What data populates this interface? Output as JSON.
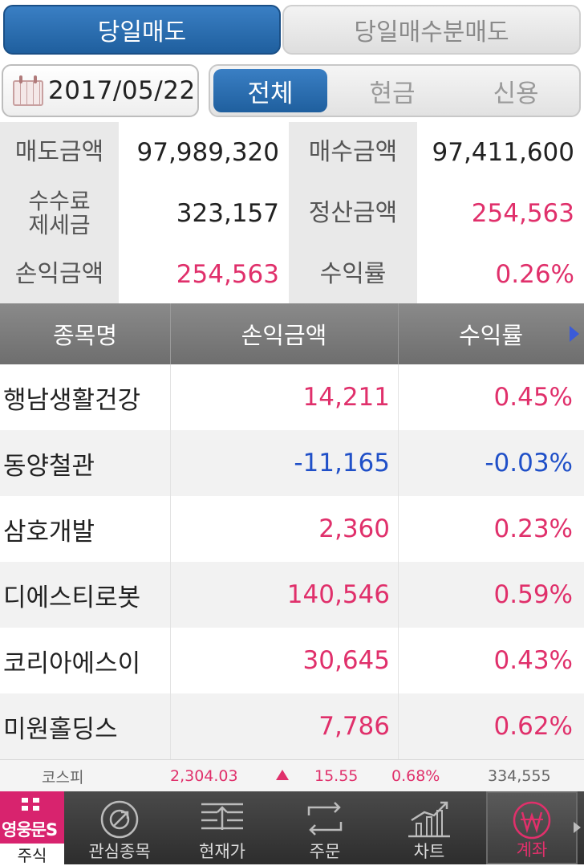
{
  "top_tabs": {
    "left": "당일매도",
    "right": "당일매수분매도"
  },
  "date": "2017/05/22",
  "filters": [
    "전체",
    "현금",
    "신용"
  ],
  "summary": {
    "row1": {
      "l1": "매도금액",
      "v1": "97,989,320",
      "l2": "매수금액",
      "v2": "97,411,600"
    },
    "row2": {
      "l1a": "수수료",
      "l1b": "제세금",
      "v1": "323,157",
      "l2": "정산금액",
      "v2": "254,563"
    },
    "row3": {
      "l1": "손익금액",
      "v1": "254,563",
      "l2": "수익률",
      "v2": "0.26%"
    }
  },
  "list_header": {
    "name": "종목명",
    "pl": "손익금액",
    "rate": "수익률"
  },
  "rows": [
    {
      "name": "행남생활건강",
      "pl": "14,211",
      "rate": "0.45%"
    },
    {
      "name": "동양철관",
      "pl": "-11,165",
      "rate": "-0.03%"
    },
    {
      "name": "삼호개발",
      "pl": "2,360",
      "rate": "0.23%"
    },
    {
      "name": "디에스티로봇",
      "pl": "140,546",
      "rate": "0.59%"
    },
    {
      "name": "코리아에스이",
      "pl": "30,645",
      "rate": "0.43%"
    },
    {
      "name": "미원홀딩스",
      "pl": "7,786",
      "rate": "0.62%"
    }
  ],
  "ticker": {
    "name": "코스피",
    "price": "2,304.03",
    "change": "15.55",
    "pct": "0.68%",
    "volume": "334,555"
  },
  "nav": {
    "home_logo": "영웅문S",
    "home": "주식",
    "watch": "관심종목",
    "price": "현재가",
    "order": "주문",
    "chart": "차트",
    "account": "계좌"
  },
  "colors": {
    "accent": "#1f5f9e",
    "up": "#e0306b",
    "down": "#2050c8",
    "brand": "#d8236e"
  }
}
